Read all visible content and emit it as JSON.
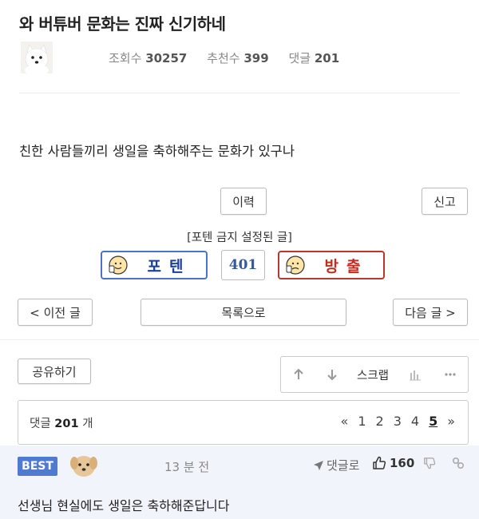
{
  "post": {
    "title": "와 버튜버 문화는 진짜 신기하네",
    "stats": {
      "views_label": "조회수",
      "views": "30257",
      "recommend_label": "추천수",
      "recommend": "399",
      "comments_label": "댓글",
      "comments": "201"
    },
    "body": "친한 사람들끼리 생일을 축하해주는 문화가 있구나"
  },
  "buttons": {
    "history": "이력",
    "report": "신고",
    "prev": "< 이전 글",
    "list": "목록으로",
    "next": "다음 글 >",
    "share": "공유하기"
  },
  "vote": {
    "notice": "[포텐 금지 설정된 글]",
    "up_label": "포텐",
    "count": "401",
    "down_label": "방출"
  },
  "toolbar": {
    "scrap": "스크랩"
  },
  "comment_bar": {
    "label": "댓글",
    "count": "201",
    "unit": "개",
    "pages": [
      "«",
      "1",
      "2",
      "3",
      "4",
      "5",
      "»"
    ],
    "current_page": "5"
  },
  "best_comment": {
    "badge": "BEST",
    "time": "13 분 전",
    "reply_label": "댓글로",
    "likes": "160",
    "text": "선생님 현실에도 생일은 축하해준답니다"
  },
  "colors": {
    "up_border": "#4a72c8",
    "down_border": "#b8382e",
    "best_badge": "#4f7ad0",
    "comment_bg": "#f1f5fb"
  }
}
